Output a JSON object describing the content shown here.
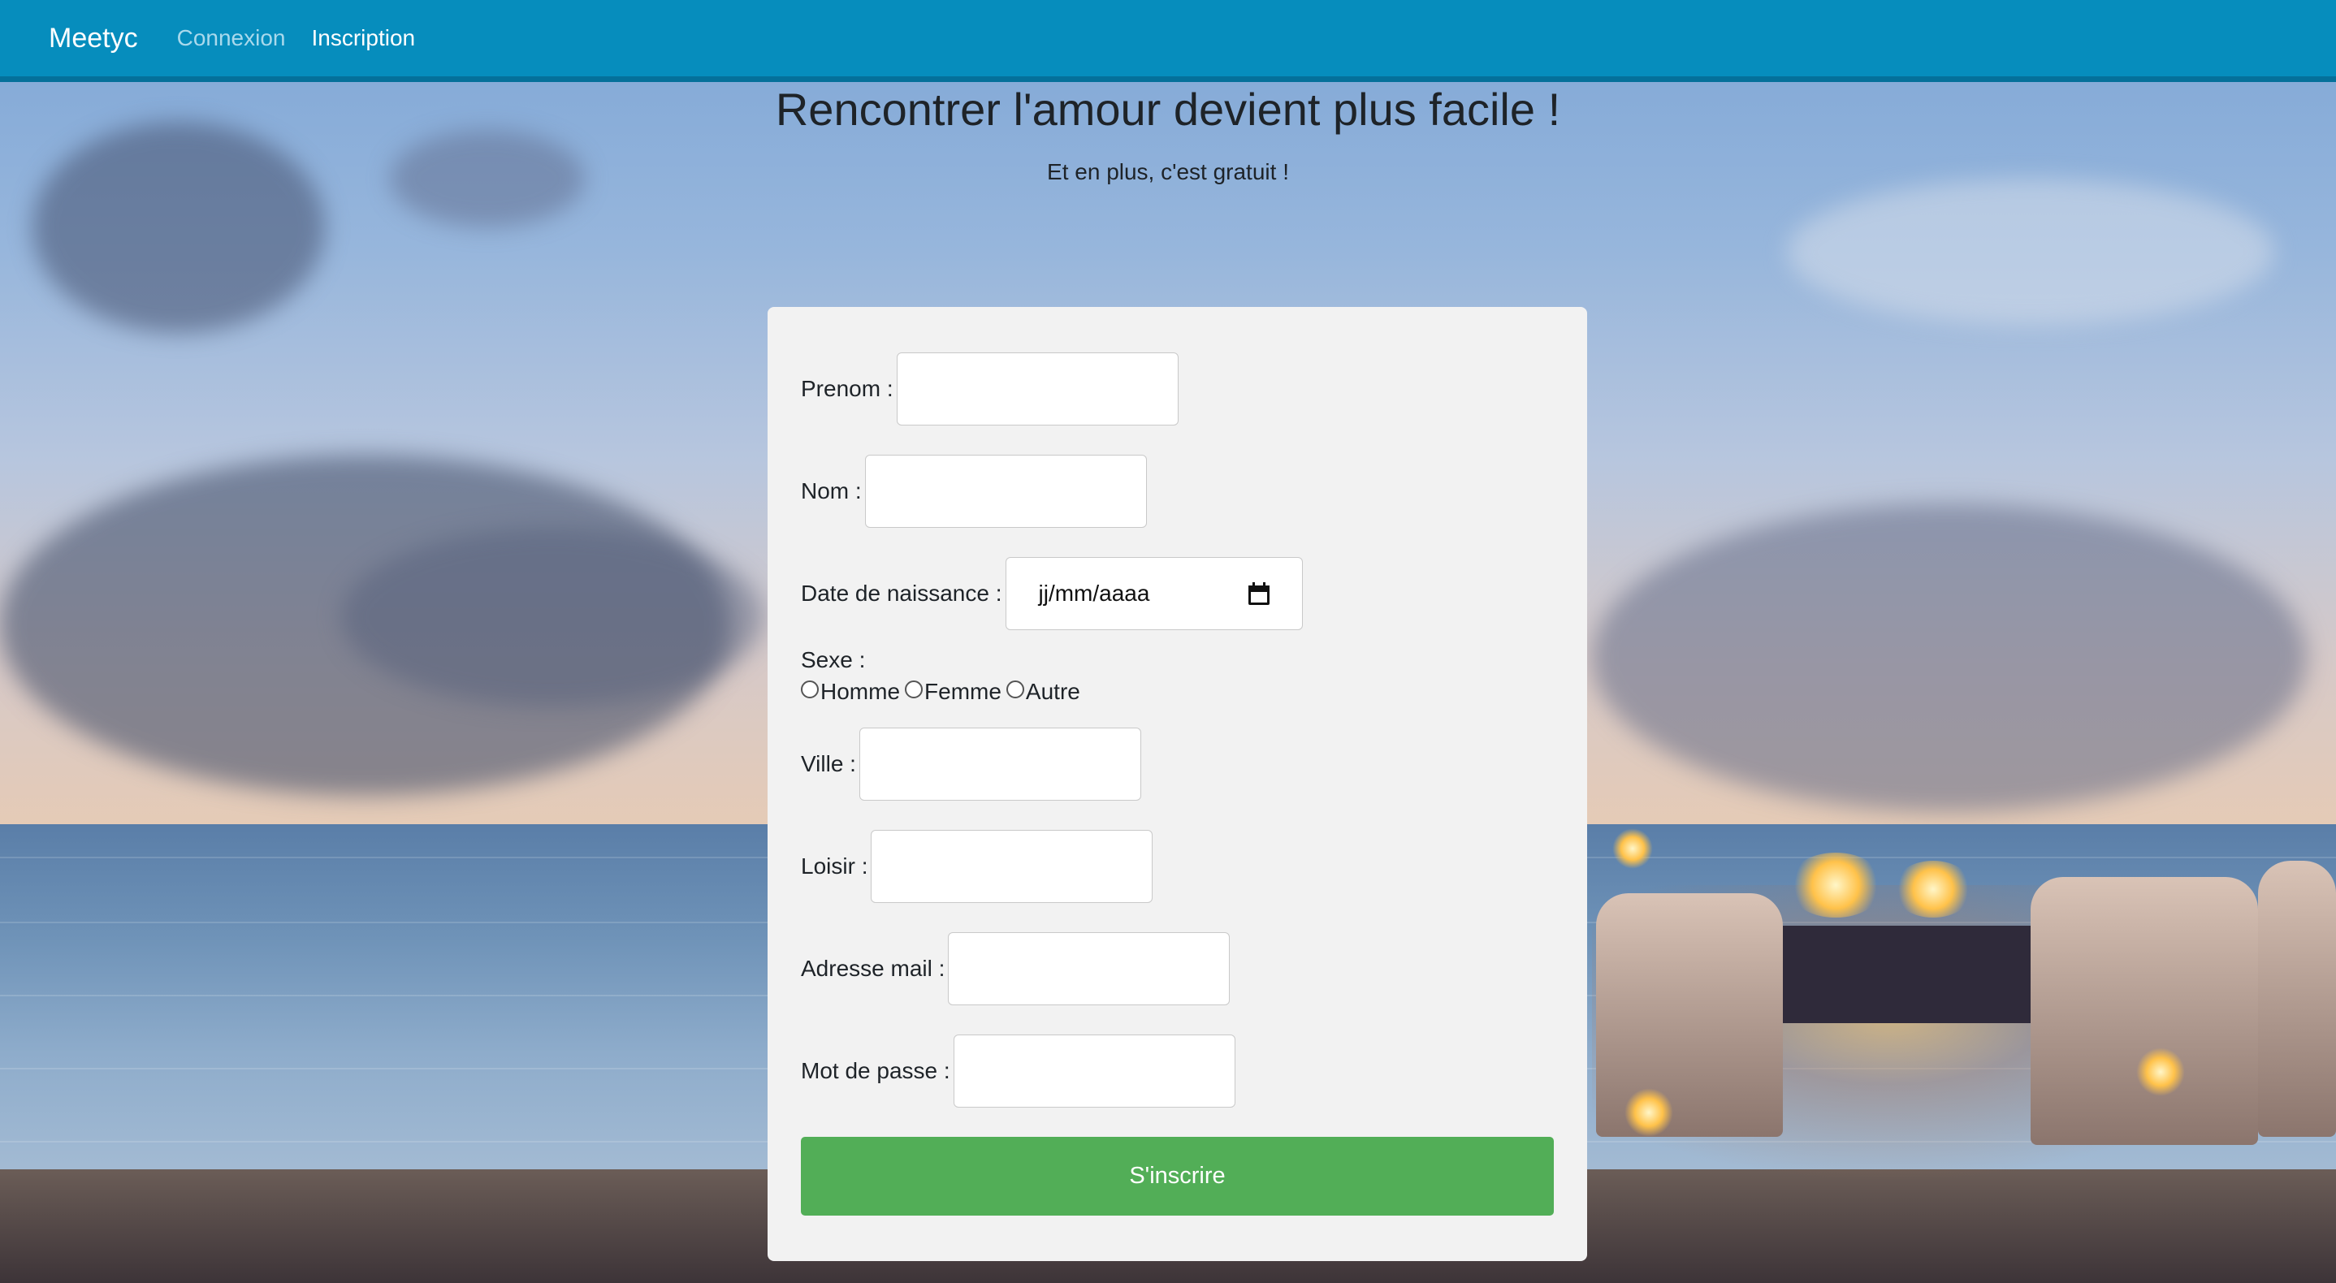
{
  "navbar": {
    "brand": "Meetyc",
    "links": [
      {
        "label": "Connexion",
        "active": false
      },
      {
        "label": "Inscription",
        "active": true
      }
    ]
  },
  "hero": {
    "title": "Rencontrer l'amour devient plus facile !",
    "subtitle": "Et en plus, c'est gratuit !"
  },
  "form": {
    "prenom_label": "Prenom :",
    "nom_label": "Nom :",
    "date_label": "Date de naissance :",
    "date_placeholder": "jj/mm/aaaa",
    "sexe_label": "Sexe :",
    "sexe_options": [
      "Homme",
      "Femme",
      "Autre"
    ],
    "ville_label": "Ville :",
    "loisir_label": "Loisir :",
    "mail_label": "Adresse mail :",
    "password_label": "Mot de passe :",
    "submit_label": "S'inscrire"
  },
  "colors": {
    "navbar": "#068dbd",
    "submit": "#52ae57",
    "card": "#f2f2f2"
  }
}
